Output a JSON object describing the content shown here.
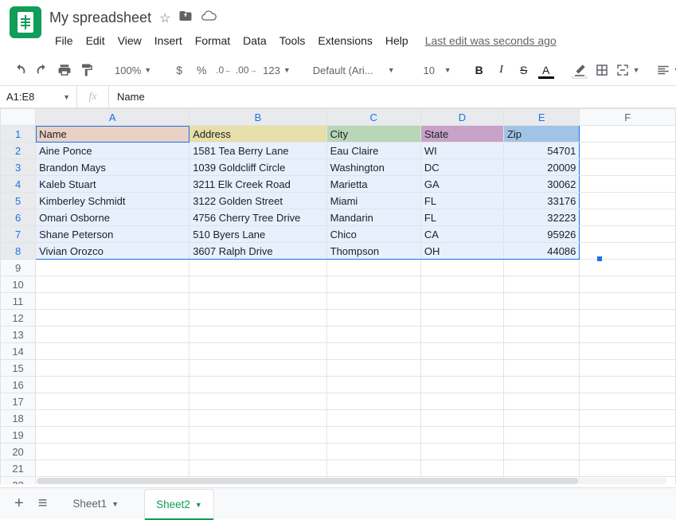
{
  "doc_title": "My spreadsheet",
  "menu": [
    "File",
    "Edit",
    "View",
    "Insert",
    "Format",
    "Data",
    "Tools",
    "Extensions",
    "Help"
  ],
  "last_edit": "Last edit was seconds ago",
  "toolbar": {
    "zoom": "100%",
    "currency": "$",
    "percent": "%",
    "dec_dec": ".0",
    "inc_dec": ".00",
    "more_fmt": "123",
    "font": "Default (Ari...",
    "font_size": "10",
    "bold": "B",
    "italic": "I",
    "strike": "S",
    "text_color": "A"
  },
  "name_box": "A1:E8",
  "fx_label": "fx",
  "formula_value": "Name",
  "columns": [
    "A",
    "B",
    "C",
    "D",
    "E",
    "F"
  ],
  "headers": {
    "name": "Name",
    "address": "Address",
    "city": "City",
    "state": "State",
    "zip": "Zip"
  },
  "header_colors": {
    "name": "#ead1c6",
    "address": "#e6dfaa",
    "city": "#b7d7b7",
    "state": "#c8a2c8",
    "zip": "#a0c4e6"
  },
  "rows": [
    {
      "name": "Aine Ponce",
      "address": "1581 Tea Berry Lane",
      "city": "Eau Claire",
      "state": "WI",
      "zip": "54701"
    },
    {
      "name": "Brandon Mays",
      "address": "1039 Goldcliff Circle",
      "city": "Washington",
      "state": "DC",
      "zip": "20009"
    },
    {
      "name": "Kaleb Stuart",
      "address": "3211 Elk Creek Road",
      "city": "Marietta",
      "state": "GA",
      "zip": "30062"
    },
    {
      "name": "Kimberley Schmidt",
      "address": "3122 Golden Street",
      "city": "Miami",
      "state": "FL",
      "zip": "33176"
    },
    {
      "name": "Omari Osborne",
      "address": "4756 Cherry Tree Drive",
      "city": "Mandarin",
      "state": "FL",
      "zip": "32223"
    },
    {
      "name": "Shane Peterson",
      "address": "510 Byers Lane",
      "city": "Chico",
      "state": "CA",
      "zip": "95926"
    },
    {
      "name": "Vivian Orozco",
      "address": "3607 Ralph Drive",
      "city": "Thompson",
      "state": "OH",
      "zip": "44086"
    }
  ],
  "sheets": {
    "tab1": "Sheet1",
    "tab2": "Sheet2"
  }
}
